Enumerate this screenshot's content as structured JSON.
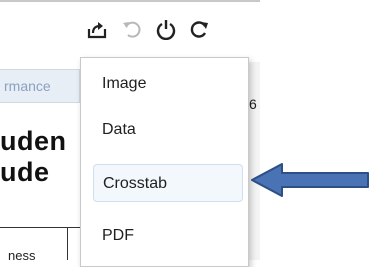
{
  "toolbar": {
    "icons": [
      "export-icon",
      "revert-icon",
      "pause-icon",
      "refresh-icon"
    ]
  },
  "background": {
    "tab_text": "rmance",
    "title_line1": "uden",
    "title_line2": "ude",
    "cell_text": "ness",
    "right_number": "6"
  },
  "menu": {
    "items": [
      {
        "label": "Image"
      },
      {
        "label": "Data"
      },
      {
        "label": "Crosstab"
      },
      {
        "label": "PDF"
      }
    ],
    "highlighted": "Crosstab"
  },
  "colors": {
    "arrow": "#4a73b5",
    "arrow_outline": "#2e4f86",
    "highlight_bg": "#f3f8fd",
    "highlight_border": "#cfdff0"
  }
}
